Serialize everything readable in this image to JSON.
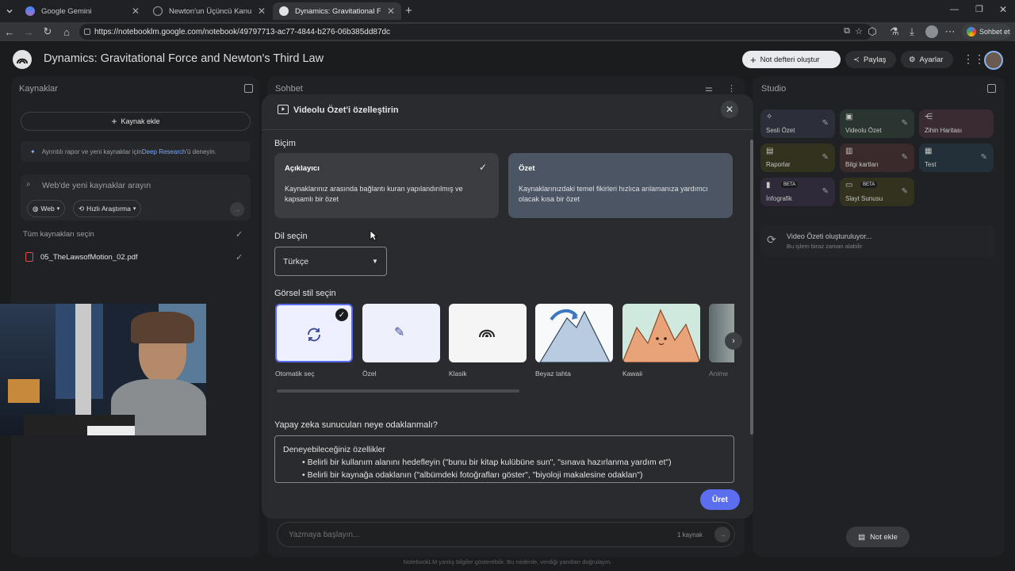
{
  "browser": {
    "tabs": [
      {
        "title": "Google Gemini",
        "active": false,
        "favicon_color": "#8ab4f8"
      },
      {
        "title": "Newton'un Üçüncü Kanunu",
        "active": false,
        "favicon_color": "#9aa0a6"
      },
      {
        "title": "Dynamics: Gravitational Force and",
        "active": true,
        "favicon_color": "#e3e3e3"
      }
    ],
    "url": "https://notebooklm.google.com/notebook/49797713-ac77-4844-b276-06b385dd87dc",
    "profile_label": "Sohbet et"
  },
  "app": {
    "title": "Dynamics: Gravitational Force and Newton's Third Law",
    "create_notebook": "Not defteri oluştur",
    "share": "Paylaş",
    "settings": "Ayarlar"
  },
  "sources": {
    "header": "Kaynaklar",
    "add_source": "Kaynak ekle",
    "deep_research_prefix": "Ayrıntılı rapor ve yeni kaynaklar için ",
    "deep_research_link": "Deep Research",
    "deep_research_suffix": "'ü deneyin.",
    "search_placeholder": "Web'de yeni kaynaklar arayın",
    "web_chip": "Web",
    "research_chip": "Hızlı Araştırma",
    "select_all": "Tüm kaynakları seçin",
    "items": [
      {
        "name": "05_TheLawsofMotion_02.pdf",
        "checked": true
      }
    ]
  },
  "chat": {
    "header": "Sohbet",
    "input_placeholder": "Yazmaya başlayın...",
    "source_count": "1 kaynak",
    "footer_note": "NotebookLM yanlış bilgiler gösterebilir. Bu nedenle, verdiği yanıtları doğrulayın."
  },
  "studio": {
    "header": "Studio",
    "tiles": [
      {
        "label": "Sesli Özet",
        "icon": "audio-sparkle-icon",
        "bg": "#2c2f3a",
        "beta": ""
      },
      {
        "label": "Videolu Özet",
        "icon": "video-icon",
        "bg": "#2a3430",
        "beta": ""
      },
      {
        "label": "Zihin Haritası",
        "icon": "mindmap-icon",
        "bg": "#3a2b33",
        "beta": ""
      },
      {
        "label": "Raporlar",
        "icon": "report-icon",
        "bg": "#33321f",
        "beta": ""
      },
      {
        "label": "Bilgi kartları",
        "icon": "flashcard-icon",
        "bg": "#3a2a2c",
        "beta": ""
      },
      {
        "label": "Test",
        "icon": "quiz-icon",
        "bg": "#23303a",
        "beta": ""
      },
      {
        "label": "İnfografik",
        "icon": "infographic-icon",
        "bg": "#2e2a3a",
        "beta": "BETA"
      },
      {
        "label": "Slayt Sunusu",
        "icon": "slides-icon",
        "bg": "#33321f",
        "beta": "BETA"
      }
    ],
    "generating_title": "Video Özeti oluşturuluyor...",
    "generating_sub": "Bu işlem biraz zaman alabilir",
    "add_note": "Not ekle"
  },
  "modal": {
    "title": "Videolu Özet'i özelleştirin",
    "format_label": "Biçim",
    "formats": [
      {
        "title": "Açıklayıcı",
        "desc": "Kaynaklarınız arasında bağlantı kuran yapılandırılmış ve kapsamlı bir özet",
        "selected": true
      },
      {
        "title": "Özet",
        "desc": "Kaynaklarınızdaki temel fikirleri hızlıca anlamanıza yardımcı olacak kısa bir özet",
        "selected": false
      }
    ],
    "language_label": "Dil seçin",
    "language_value": "Türkçe",
    "style_label": "Görsel stil seçin",
    "styles": [
      {
        "label": "Otomatik seç",
        "selected": true
      },
      {
        "label": "Özel",
        "selected": false
      },
      {
        "label": "Klasik",
        "selected": false
      },
      {
        "label": "Beyaz tahta",
        "selected": false
      },
      {
        "label": "Kawaii",
        "selected": false
      },
      {
        "label": "Anime",
        "selected": false
      }
    ],
    "focus_label": "Yapay zeka sunucuları neye odaklanmalı?",
    "focus_heading": "Deneyebileceğiniz özellikler",
    "focus_items": [
      "Belirli bir kullanım alanını hedefleyin (\"bunu bir kitap kulübüne sun\", \"sınava hazırlanma yardım et\")",
      "Belirli bir kaynağa odaklanın (\"albümdeki fotoğrafları göster\", \"biyoloji makalesine odaklan\")"
    ],
    "generate_button": "Üret"
  },
  "colors": {
    "accent": "#5b6ef0",
    "selected_card": "#4b5563",
    "unselected_card": "#3b3d41",
    "link": "#7aa7ff"
  }
}
